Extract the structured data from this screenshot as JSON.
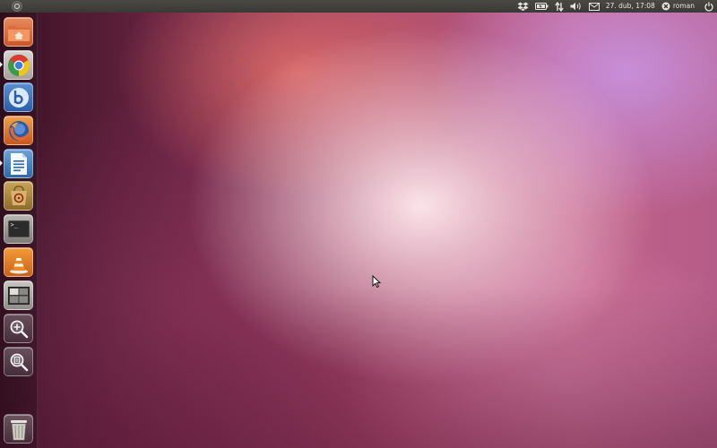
{
  "top_panel": {
    "ubuntu_button": "ubuntu-logo-icon",
    "indicators": {
      "dropbox": "dropbox-icon",
      "battery": "battery-icon",
      "network": "network-transfer-icon",
      "volume": "speaker-icon",
      "messaging": "envelope-icon",
      "clock": "27. dub, 17:08",
      "user_icon": "user-status-icon",
      "user_name": "roman",
      "power": "power-icon"
    }
  },
  "launcher": {
    "items": [
      {
        "name": "home-folder",
        "icon": "folder-home-icon",
        "running": false
      },
      {
        "name": "chrome",
        "icon": "chrome-icon",
        "running": true
      },
      {
        "name": "b-app",
        "icon": "b-letter-icon",
        "running": false
      },
      {
        "name": "firefox",
        "icon": "firefox-icon",
        "running": false
      },
      {
        "name": "libreoffice-writer",
        "icon": "document-icon",
        "running": true
      },
      {
        "name": "software-center",
        "icon": "software-center-icon",
        "running": false
      },
      {
        "name": "terminal",
        "icon": "terminal-icon",
        "running": false,
        "prompt": ">_"
      },
      {
        "name": "vlc",
        "icon": "vlc-cone-icon",
        "running": false
      },
      {
        "name": "workspace-switcher",
        "icon": "workspaces-icon",
        "running": false
      },
      {
        "name": "dash-apps",
        "icon": "plus-magnifier-icon",
        "running": false
      },
      {
        "name": "dash-files",
        "icon": "files-magnifier-icon",
        "running": false
      },
      {
        "name": "trash",
        "icon": "trash-icon",
        "running": false
      }
    ]
  },
  "colors": {
    "panel": "#3c3b37",
    "launcher": "#4a1a30",
    "wallpaper_accent": "#c2638a"
  }
}
